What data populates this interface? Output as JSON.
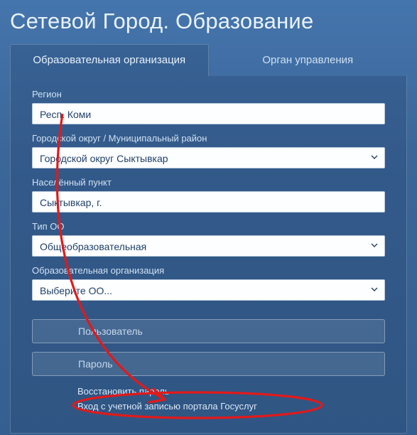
{
  "title": "Сетевой Город. Образование",
  "tabs": {
    "org": "Образовательная организация",
    "gov": "Орган управления"
  },
  "fields": {
    "region": {
      "label": "Регион",
      "value": "Респ. Коми"
    },
    "district": {
      "label": "Городской округ / Муниципальный район",
      "value": "Городской округ Сыктывкар"
    },
    "locality": {
      "label": "Населённый пункт",
      "value": "Сыктывкар, г."
    },
    "ootype": {
      "label": "Тип ОО",
      "value": "Общеобразовательная"
    },
    "org": {
      "label": "Образовательная организация",
      "value": "Выберите ОО..."
    }
  },
  "credentials": {
    "user_placeholder": "Пользователь",
    "pass_placeholder": "Пароль"
  },
  "links": {
    "restore": "Восстановить пароль",
    "gosuslugi": "Вход с учетной записью портала Госуслуг"
  },
  "colors": {
    "annotation": "#e11a1a"
  }
}
